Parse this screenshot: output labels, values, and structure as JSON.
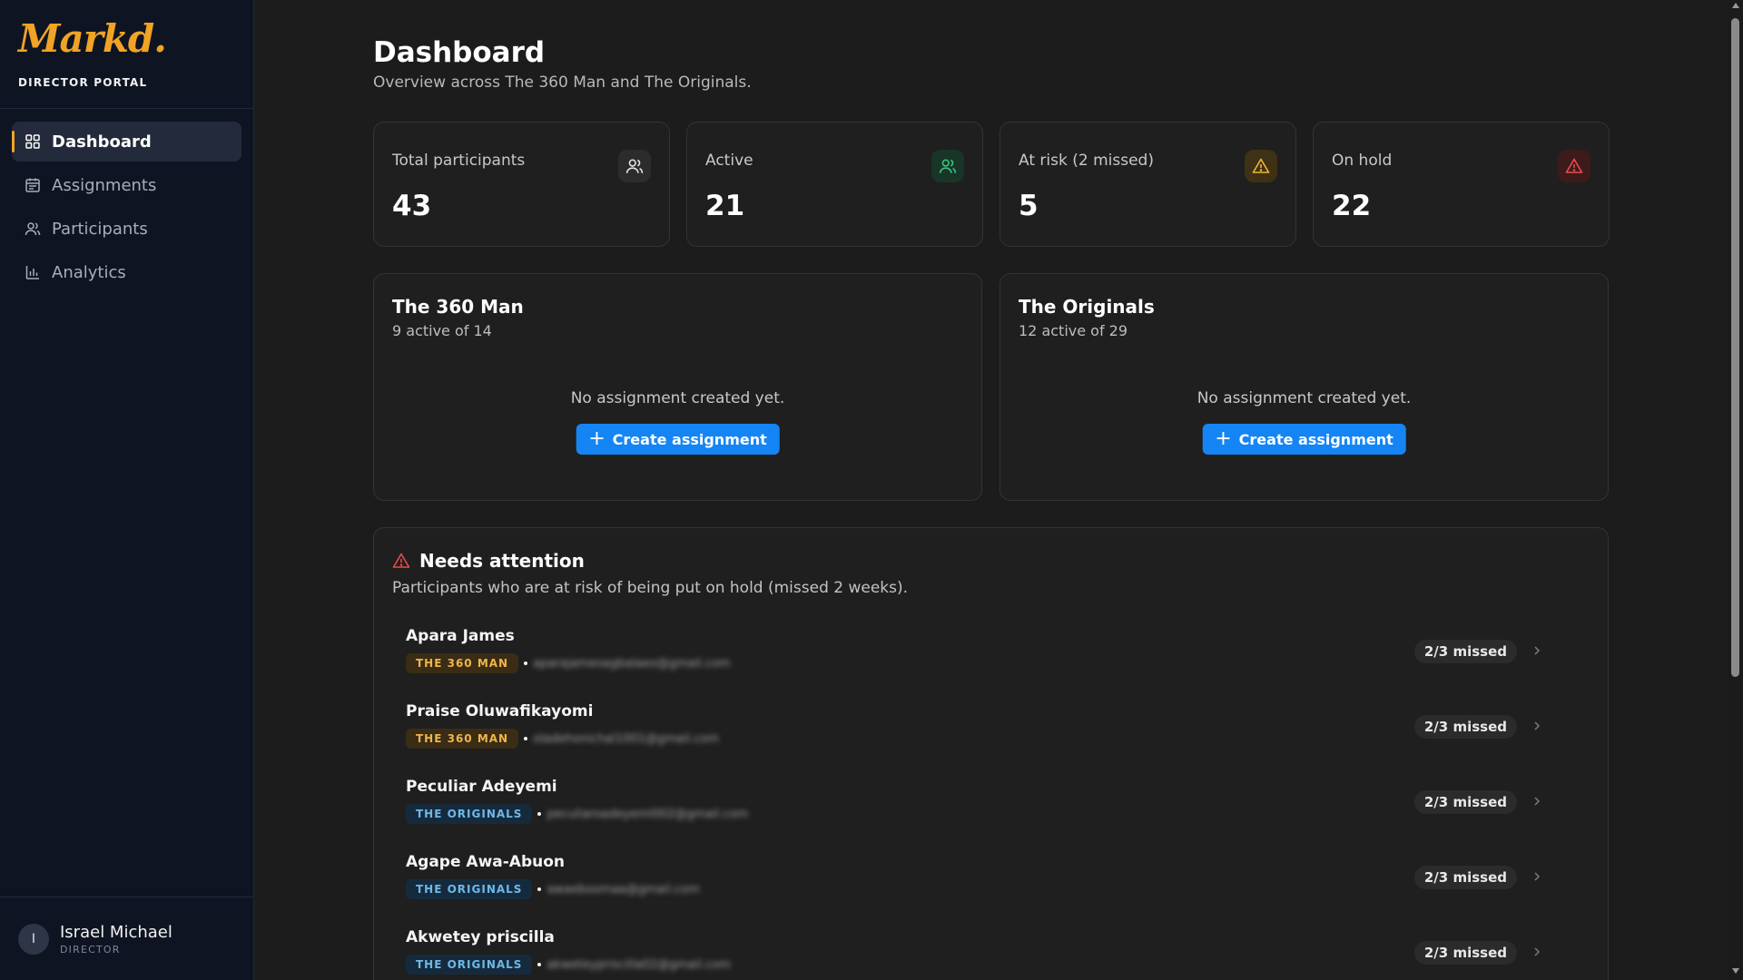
{
  "app": {
    "logo_text": "Markd.",
    "portal_label": "DIRECTOR PORTAL",
    "accent_color": "#f0a324"
  },
  "sidebar": {
    "items": [
      {
        "label": "Dashboard",
        "icon": "grid-icon",
        "active": true
      },
      {
        "label": "Assignments",
        "icon": "calendar-icon",
        "active": false
      },
      {
        "label": "Participants",
        "icon": "users-icon",
        "active": false
      },
      {
        "label": "Analytics",
        "icon": "bar-chart-icon",
        "active": false
      }
    ],
    "user": {
      "initial": "I",
      "name": "Israel Michael",
      "role": "DIRECTOR"
    }
  },
  "page": {
    "title": "Dashboard",
    "subtitle": "Overview across The 360 Man and The Originals."
  },
  "stats": [
    {
      "label": "Total participants",
      "value": "43",
      "icon": "users-icon",
      "icon_color": "#e0e0e0",
      "icon_bg": "#2c2c2c"
    },
    {
      "label": "Active",
      "value": "21",
      "icon": "users-icon",
      "icon_color": "#35c27a",
      "icon_bg": "#183528"
    },
    {
      "label": "At risk (2 missed)",
      "value": "5",
      "icon": "warning-icon",
      "icon_color": "#f0b43a",
      "icon_bg": "#3e3114"
    },
    {
      "label": "On hold",
      "value": "22",
      "icon": "warning-icon",
      "icon_color": "#ee4a4a",
      "icon_bg": "#3d1b1b"
    }
  ],
  "groups": [
    {
      "title": "The 360 Man",
      "subtitle": "9 active of 14",
      "empty_text": "No assignment created yet.",
      "button": "Create assignment"
    },
    {
      "title": "The Originals",
      "subtitle": "12 active of 29",
      "empty_text": "No assignment created yet.",
      "button": "Create assignment"
    }
  ],
  "attention": {
    "title": "Needs attention",
    "subtitle": "Participants who are at risk of being put on hold (missed 2 weeks).",
    "rows": [
      {
        "name": "Apara James",
        "group": "THE 360 MAN",
        "email": "aparajamesagbalaeo@gmail.com",
        "status": "2/3 missed"
      },
      {
        "name": "Praise Oluwafikayomi",
        "group": "THE 360 MAN",
        "email": "oladehonichal1001@gmail.com",
        "status": "2/3 missed"
      },
      {
        "name": "Peculiar Adeyemi",
        "group": "THE ORIGINALS",
        "email": "peculiaroadeyemi002@gmail.com",
        "status": "2/3 missed"
      },
      {
        "name": "Agape Awa-Abuon",
        "group": "THE ORIGINALS",
        "email": "awaeboomaa@gmail.com",
        "status": "2/3 missed"
      },
      {
        "name": "Akwetey priscilla",
        "group": "THE ORIGINALS",
        "email": "akweteypriscilla02@gmail.com",
        "status": "2/3 missed"
      }
    ]
  }
}
